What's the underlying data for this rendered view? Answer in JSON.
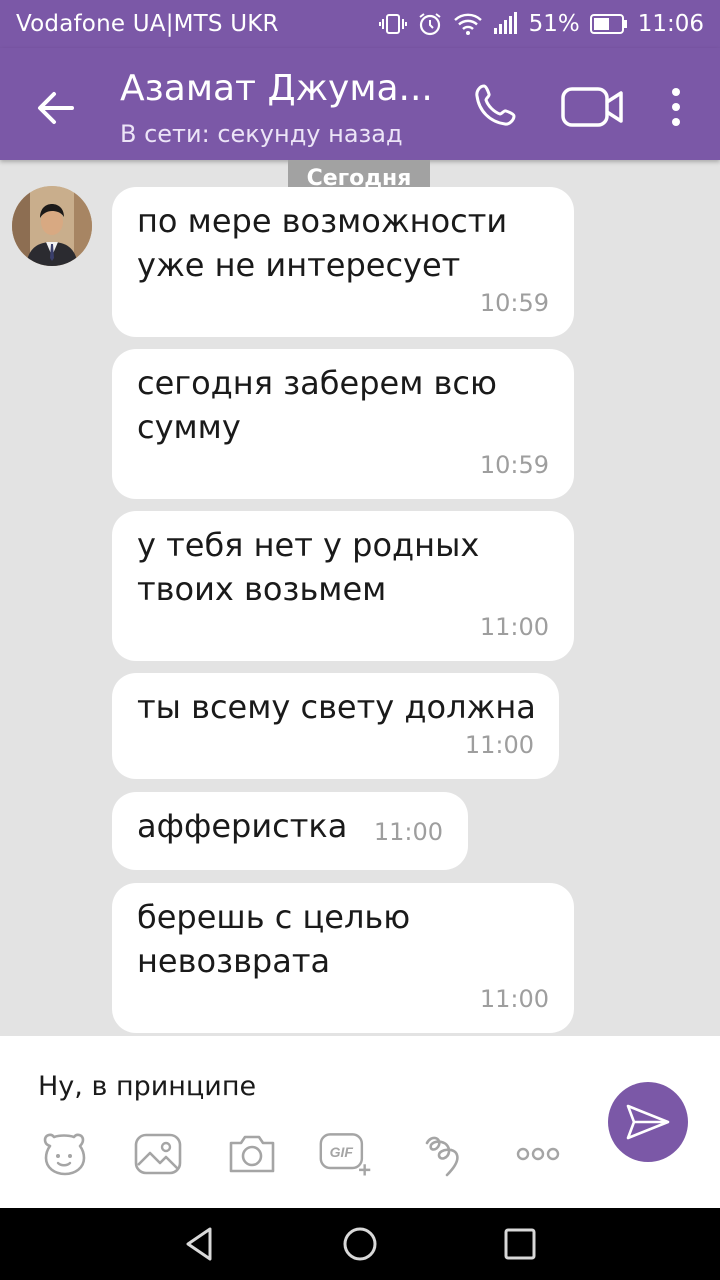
{
  "status_bar": {
    "carrier": "Vodafone UA|MTS UKR",
    "battery": "51%",
    "time": "11:06"
  },
  "header": {
    "contact_name": "Азамат Джума...",
    "contact_status": "В сети: секунду назад"
  },
  "chat": {
    "date_label": "Сегодня",
    "messages": [
      {
        "lines": [
          "по мере возможности",
          "уже не интересует"
        ],
        "time": "10:59"
      },
      {
        "lines": [
          "сегодня заберем всю",
          "сумму"
        ],
        "time": "10:59"
      },
      {
        "lines": [
          "у тебя нет у родных",
          "твоих возьмем"
        ],
        "time": "11:00"
      },
      {
        "lines": [
          "ты всему свету должна"
        ],
        "time": "11:00"
      },
      {
        "lines": [
          "афферистка"
        ],
        "time": "11:00"
      },
      {
        "lines": [
          "берешь с целью",
          "невозврата"
        ],
        "time": "11:00"
      }
    ]
  },
  "composer": {
    "input_value": "Ну, в принципе",
    "gif_label": "GIF"
  },
  "colors": {
    "accent": "#7b58a7",
    "chat_background": "#e3e3e3",
    "bubble": "#ffffff",
    "date_chip": "#a2a2a2"
  }
}
